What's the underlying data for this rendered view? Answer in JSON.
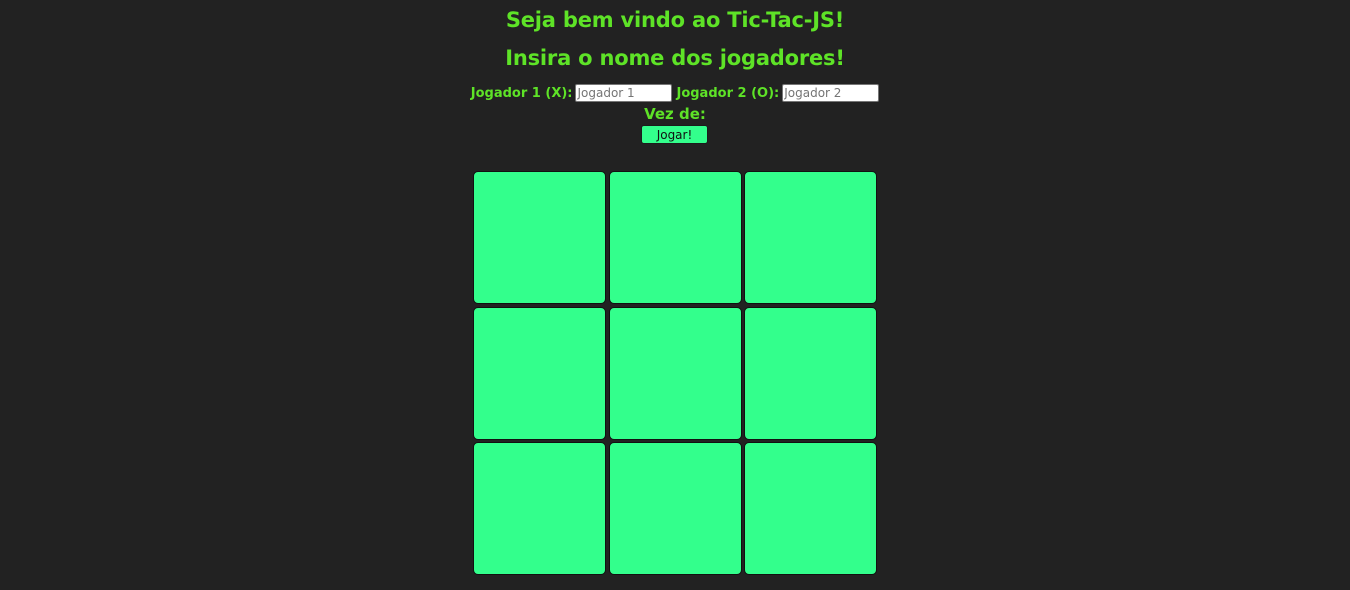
{
  "header": {
    "welcome_title": "Seja bem vindo ao Tic-Tac-JS!",
    "instruction_title": "Insira o nome dos jogadores!"
  },
  "players": {
    "player1_label": "Jogador 1 (X):",
    "player1_placeholder": "Jogador 1",
    "player1_value": "",
    "player2_label": "Jogador 2 (O):",
    "player2_placeholder": "Jogador 2",
    "player2_value": ""
  },
  "turn": {
    "label": "Vez de:",
    "current": ""
  },
  "controls": {
    "play_label": "Jogar!"
  },
  "board": {
    "cells": [
      "",
      "",
      "",
      "",
      "",
      "",
      "",
      "",
      ""
    ]
  },
  "colors": {
    "background": "#222222",
    "text_accent": "#5ee327",
    "cell_fill": "#33ff8c"
  }
}
